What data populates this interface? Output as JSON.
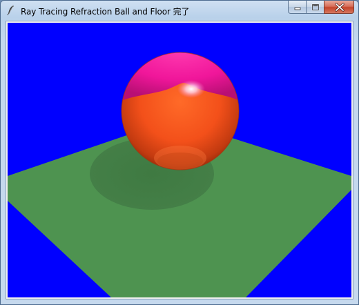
{
  "window": {
    "title": "Ray Tracing Refraction Ball and Floor 完了"
  },
  "controls": {
    "minimize_icon": "minimize-icon",
    "maximize_icon": "maximize-icon",
    "close_icon": "close-icon"
  },
  "scene": {
    "background_color": "#0000ff",
    "floor_color": "#4e9350",
    "ball_color": "#ff4a1c",
    "ball_highlight_color": "#ff1fa0"
  }
}
